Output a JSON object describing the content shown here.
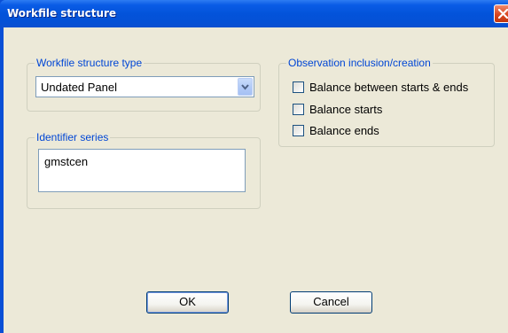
{
  "window": {
    "title": "Workfile structure",
    "close_icon": "close-x-icon"
  },
  "structure_type": {
    "label": "Workfile structure type",
    "selected": "Undated Panel",
    "arrow_icon": "chevron-down-icon"
  },
  "identifier": {
    "label": "Identifier series",
    "value": "gmstcen"
  },
  "observation": {
    "label": "Observation inclusion/creation",
    "options": [
      {
        "label": "Balance between starts & ends",
        "checked": false
      },
      {
        "label": "Balance starts",
        "checked": false
      },
      {
        "label": "Balance ends",
        "checked": false
      }
    ]
  },
  "buttons": {
    "ok": "OK",
    "cancel": "Cancel"
  },
  "colors": {
    "titlebar": "#0353da",
    "dialog_bg": "#ece9d8",
    "group_label": "#0046d5",
    "close_button": "#d9461f"
  }
}
